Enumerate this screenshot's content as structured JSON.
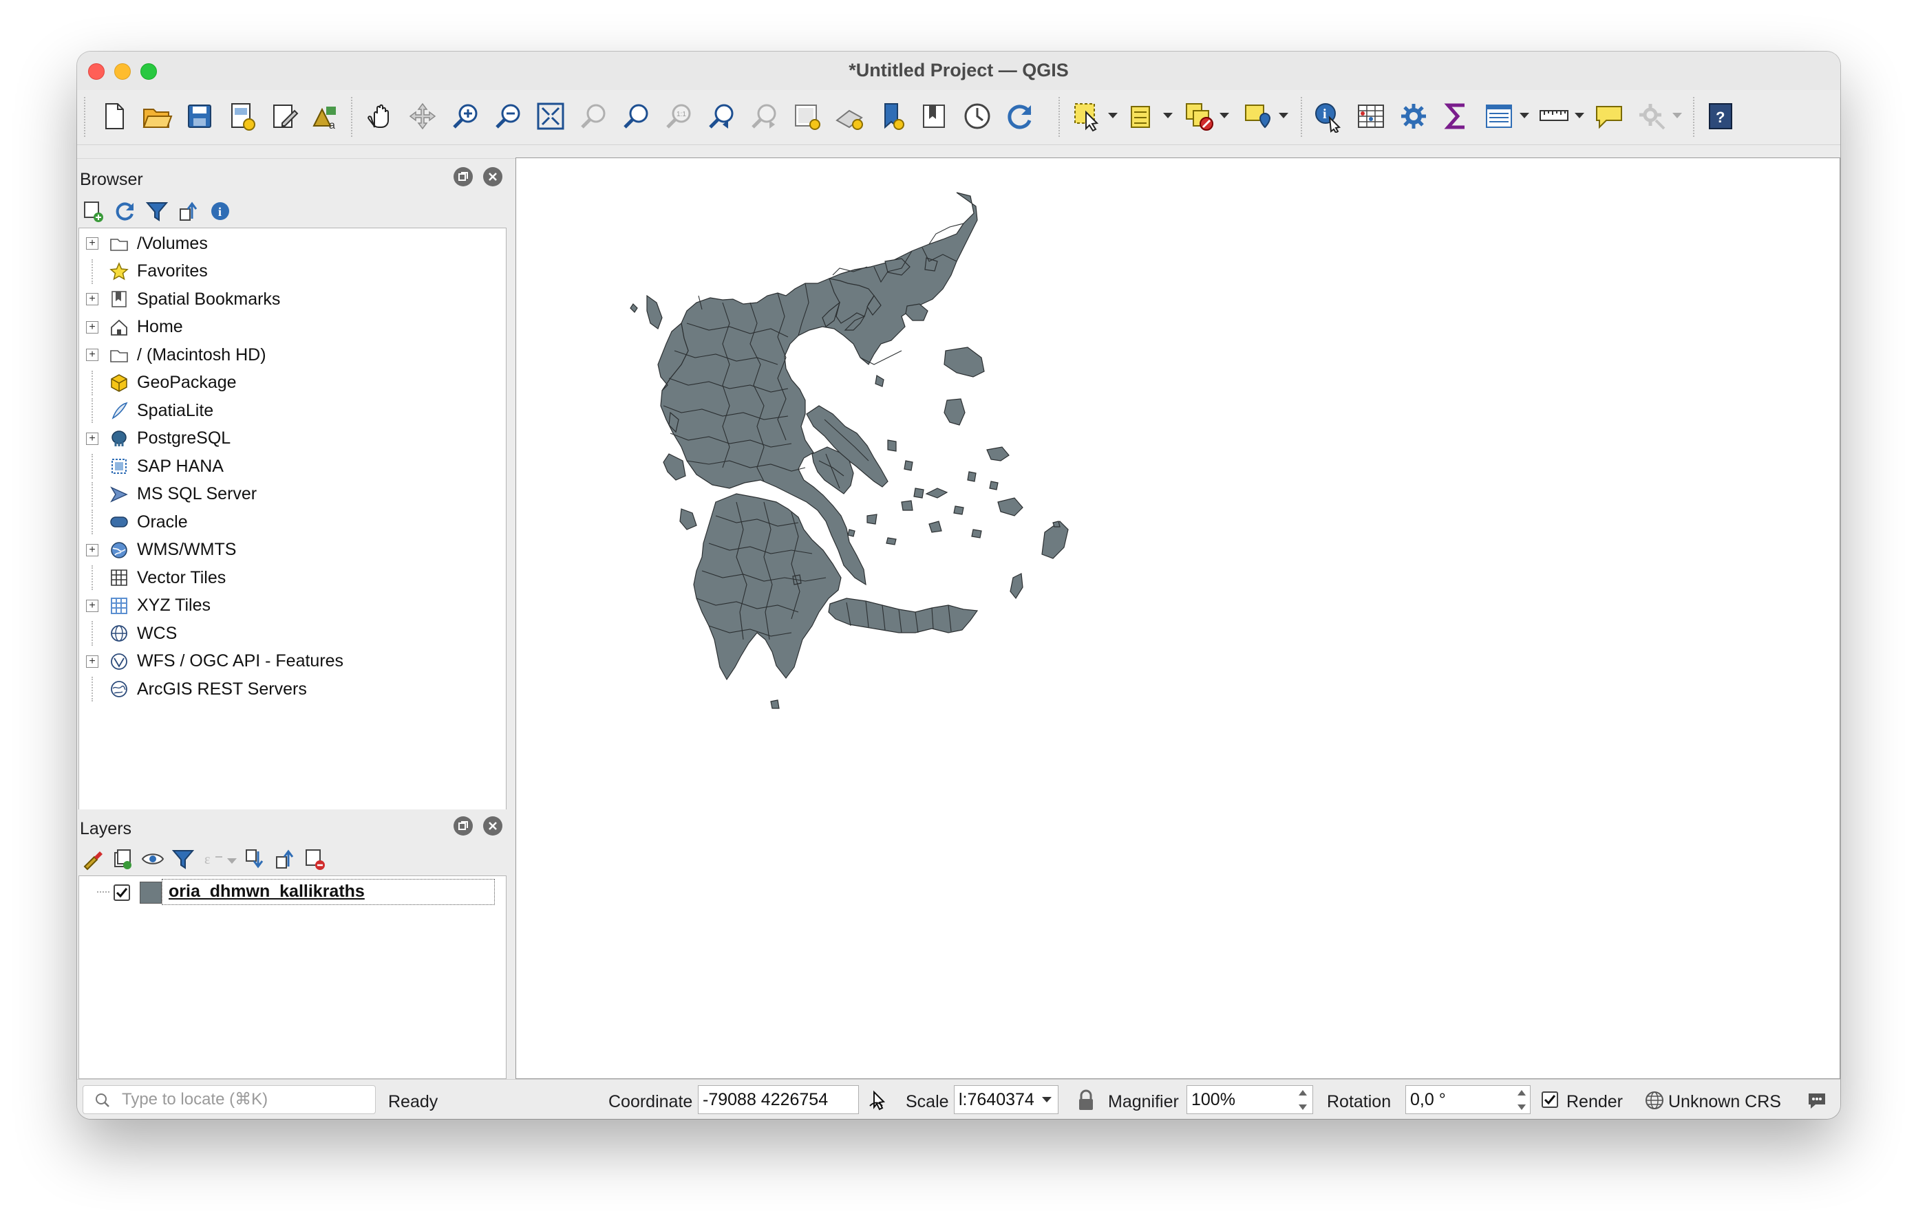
{
  "window": {
    "title": "*Untitled Project — QGIS"
  },
  "toolbar": {
    "buttons": [
      "new-project-icon",
      "open-project-icon",
      "save-project-icon",
      "new-print-layout-icon",
      "layout-manager-icon",
      "style-manager-icon",
      "pan-icon",
      "pan-to-selection-icon",
      "zoom-in-icon",
      "zoom-out-icon",
      "zoom-full-icon",
      "zoom-to-selection-icon",
      "zoom-to-layer-icon",
      "zoom-native-icon",
      "zoom-last-icon",
      "zoom-next-icon",
      "new-map-view-icon",
      "new-3d-map-icon",
      "new-bookmark-icon",
      "show-bookmarks-icon",
      "temporal-controller-icon",
      "refresh-icon",
      "select-features-icon",
      "select-by-value-icon",
      "deselect-icon",
      "select-by-location-icon",
      "identify-icon",
      "attribute-table-icon",
      "processing-toolbox-icon",
      "statistics-icon",
      "open-field-calculator-icon",
      "measure-icon",
      "map-tips-icon",
      "plugins-icon",
      "help-icon"
    ]
  },
  "browser": {
    "title": "Browser",
    "items": [
      {
        "label": "/Volumes",
        "icon": "folder-icon",
        "expandable": true
      },
      {
        "label": "Favorites",
        "icon": "star-icon",
        "expandable": false
      },
      {
        "label": "Spatial Bookmarks",
        "icon": "bookmark-icon",
        "expandable": true
      },
      {
        "label": "Home",
        "icon": "home-icon",
        "expandable": true
      },
      {
        "label": "/ (Macintosh HD)",
        "icon": "folder-icon",
        "expandable": true
      },
      {
        "label": "GeoPackage",
        "icon": "geopackage-icon",
        "expandable": false
      },
      {
        "label": "SpatiaLite",
        "icon": "spatialite-icon",
        "expandable": false
      },
      {
        "label": "PostgreSQL",
        "icon": "postgresql-icon",
        "expandable": true
      },
      {
        "label": "SAP HANA",
        "icon": "sap-hana-icon",
        "expandable": false
      },
      {
        "label": "MS SQL Server",
        "icon": "mssql-icon",
        "expandable": false
      },
      {
        "label": "Oracle",
        "icon": "oracle-icon",
        "expandable": false
      },
      {
        "label": "WMS/WMTS",
        "icon": "wms-icon",
        "expandable": true
      },
      {
        "label": "Vector Tiles",
        "icon": "vector-tiles-icon",
        "expandable": false
      },
      {
        "label": "XYZ Tiles",
        "icon": "xyz-tiles-icon",
        "expandable": true
      },
      {
        "label": "WCS",
        "icon": "wcs-icon",
        "expandable": false
      },
      {
        "label": "WFS / OGC API - Features",
        "icon": "wfs-icon",
        "expandable": true
      },
      {
        "label": "ArcGIS REST Servers",
        "icon": "arcgis-icon",
        "expandable": false
      }
    ]
  },
  "layers": {
    "title": "Layers",
    "items": [
      {
        "label": "oria_dhmwn_kallikraths",
        "checked": true,
        "swatch_color": "#6e7b80"
      }
    ]
  },
  "map": {
    "fill_color": "#6e7b80",
    "stroke_color": "#2b2f31"
  },
  "statusbar": {
    "locator_placeholder": "Type to locate (⌘K)",
    "status": "Ready",
    "coordinate_label": "Coordinate",
    "coordinate_value": "-79088  4226754",
    "scale_label": "Scale",
    "scale_value": "l:7640374",
    "magnifier_label": "Magnifier",
    "magnifier_value": "100%",
    "rotation_label": "Rotation",
    "rotation_value": "0,0 °",
    "render_label": "Render",
    "render_checked": true,
    "crs_label": "Unknown CRS"
  }
}
